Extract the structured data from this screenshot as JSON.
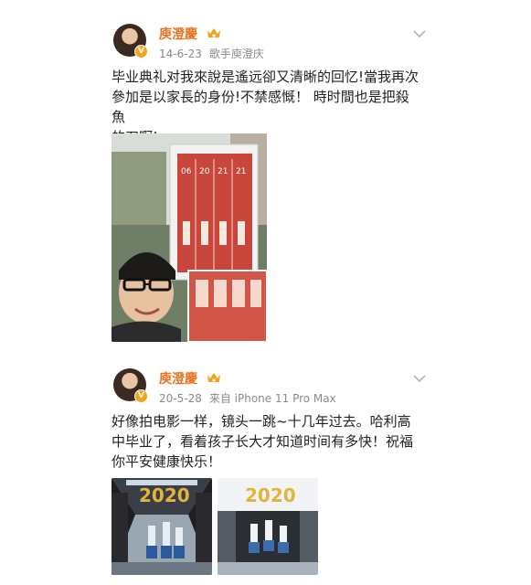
{
  "posts": [
    {
      "author": "庾澄慶",
      "date": "14-6-23",
      "source": "歌手庾澄庆",
      "text_lines": [
        "毕业典礼对我來說是遙远卻又清晰的回忆!當我再次",
        "參加是以家長的身份!不禁感慨！ 時时間也是把殺魚",
        "的刀啊!"
      ],
      "verified_badge": "V",
      "icons": [
        "avatar",
        "crown-icon",
        "chevron-down-icon"
      ]
    },
    {
      "author": "庾澄慶",
      "date": "20-5-28",
      "source": "来自 iPhone 11 Pro Max",
      "text_lines": [
        "好像拍电影一样，镜头一跳~十几年过去。哈利高",
        "中毕业了，看着孩子长大才知道时间有多快！祝福",
        "你平安健康快乐！"
      ],
      "verified_badge": "V",
      "icons": [
        "avatar",
        "crown-icon",
        "chevron-down-icon"
      ]
    }
  ],
  "photo_text": {
    "board_dates": [
      "06",
      "20",
      "21",
      "21"
    ],
    "banner_2020": "2020"
  },
  "colors": {
    "author_name": "#e8731f",
    "meta_gray": "#8a8a8a",
    "board_red": "#c9463d",
    "crown_gold": "#f2a31a"
  }
}
